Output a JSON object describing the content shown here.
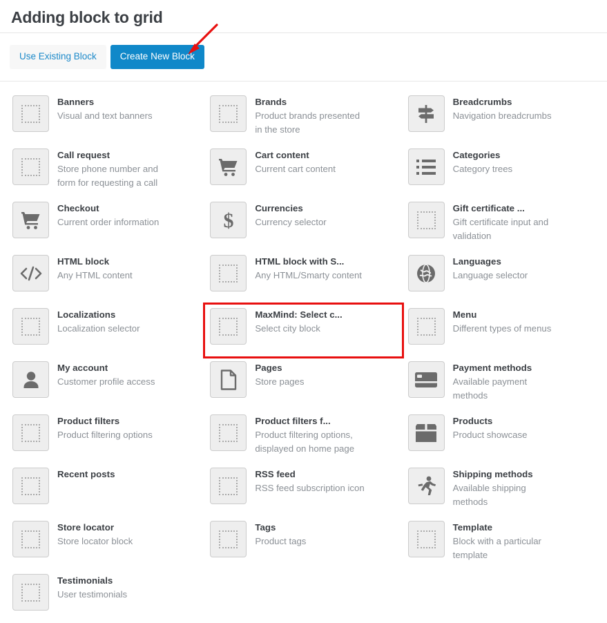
{
  "header": {
    "title": "Adding block to grid"
  },
  "tabbar": {
    "use_existing_label": "Use Existing Block",
    "create_new_label": "Create New Block"
  },
  "annotation": {
    "arrow_color": "#e8100f",
    "highlight_color": "#e8100f",
    "highlighted_block": "MaxMind: Select c..."
  },
  "theme": {
    "primary_button_bg": "#1088c9",
    "ghost_button_bg": "#f7f7f7",
    "link_blue": "#1b89c9",
    "icon_tile_bg": "#eeeeee",
    "icon_tile_border": "#cccccc",
    "title_color": "#3b3f44",
    "desc_color": "#8b9096"
  },
  "columns": [
    {
      "items": [
        {
          "name": "Banners",
          "desc": "Visual and text banners",
          "icon": "placeholder-icon",
          "highlighted": false
        },
        {
          "name": "Call request",
          "desc": "Store phone number and form for requesting a call",
          "icon": "placeholder-icon",
          "highlighted": false
        },
        {
          "name": "Checkout",
          "desc": "Current order information",
          "icon": "shopping-cart-icon",
          "highlighted": false
        },
        {
          "name": "HTML block",
          "desc": "Any HTML content",
          "icon": "code-icon",
          "highlighted": false
        },
        {
          "name": "Localizations",
          "desc": "Localization selector",
          "icon": "placeholder-icon",
          "highlighted": false
        },
        {
          "name": "My account",
          "desc": "Customer profile access",
          "icon": "user-icon",
          "highlighted": false
        },
        {
          "name": "Product filters",
          "desc": "Product filtering options",
          "icon": "placeholder-icon",
          "highlighted": false
        },
        {
          "name": "Recent posts",
          "desc": "",
          "icon": "placeholder-icon",
          "highlighted": false
        },
        {
          "name": "Store locator",
          "desc": "Store locator block",
          "icon": "placeholder-icon",
          "highlighted": false
        },
        {
          "name": "Testimonials",
          "desc": "User testimonials",
          "icon": "placeholder-icon",
          "highlighted": false
        }
      ]
    },
    {
      "items": [
        {
          "name": "Brands",
          "desc": "Product brands presented in the store",
          "icon": "placeholder-icon",
          "highlighted": false
        },
        {
          "name": "Cart content",
          "desc": "Current cart content",
          "icon": "cart-full-icon",
          "highlighted": false
        },
        {
          "name": "Currencies",
          "desc": "Currency selector",
          "icon": "dollar-icon",
          "highlighted": false
        },
        {
          "name": "HTML block with S...",
          "desc": "Any HTML/Smarty content",
          "icon": "placeholder-icon",
          "highlighted": false
        },
        {
          "name": "MaxMind: Select c...",
          "desc": "Select city block",
          "icon": "placeholder-icon",
          "highlighted": true
        },
        {
          "name": "Pages",
          "desc": "Store pages",
          "icon": "page-icon",
          "highlighted": false
        },
        {
          "name": "Product filters f...",
          "desc": "Product filtering options, displayed on home page",
          "icon": "placeholder-icon",
          "highlighted": false
        },
        {
          "name": "RSS feed",
          "desc": "RSS feed subscription icon",
          "icon": "placeholder-icon",
          "highlighted": false
        },
        {
          "name": "Tags",
          "desc": "Product tags",
          "icon": "placeholder-icon",
          "highlighted": false
        }
      ]
    },
    {
      "items": [
        {
          "name": "Breadcrumbs",
          "desc": "Navigation breadcrumbs",
          "icon": "signpost-icon",
          "highlighted": false
        },
        {
          "name": "Categories",
          "desc": "Category trees",
          "icon": "list-icon",
          "highlighted": false
        },
        {
          "name": "Gift certificate ...",
          "desc": "Gift certificate input and validation",
          "icon": "placeholder-icon",
          "highlighted": false
        },
        {
          "name": "Languages",
          "desc": "Language selector",
          "icon": "globe-icon",
          "highlighted": false
        },
        {
          "name": "Menu",
          "desc": "Different types of menus",
          "icon": "placeholder-icon",
          "highlighted": false
        },
        {
          "name": "Payment methods",
          "desc": "Available payment methods",
          "icon": "credit-card-icon",
          "highlighted": false
        },
        {
          "name": "Products",
          "desc": "Product showcase",
          "icon": "box-icon",
          "highlighted": false
        },
        {
          "name": "Shipping methods",
          "desc": "Available shipping methods",
          "icon": "runner-icon",
          "highlighted": false
        },
        {
          "name": "Template",
          "desc": "Block with a particular template",
          "icon": "placeholder-icon",
          "highlighted": false
        }
      ]
    }
  ]
}
